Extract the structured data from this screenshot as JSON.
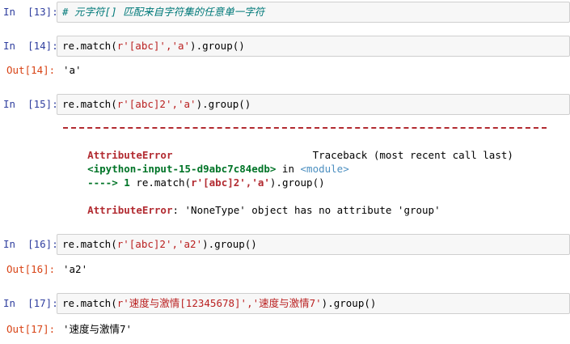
{
  "cells": {
    "c13": {
      "prompt": "In  [13]:",
      "comment": "# 元字符[] 匹配来自字符集的任意单一字符"
    },
    "c14": {
      "prompt": "In  [14]:",
      "code_pre": "re.match(",
      "code_str": "r'[abc]','a'",
      "code_post": ").group()",
      "out_prompt": "Out[14]:",
      "output": "'a'"
    },
    "c15": {
      "prompt": "In  [15]:",
      "code_pre": "re.match(",
      "code_str": "r'[abc]2','a'",
      "code_post": ").group()",
      "tb_error": "AttributeError",
      "tb_traceback": "Traceback (most recent call last)",
      "tb_input": "<ipython-input-15-d9abc7c84edb>",
      "tb_in": " in ",
      "tb_module": "<module>",
      "tb_arrow": "----> 1 ",
      "tb_code_pre": "re.match(",
      "tb_code_str": "r'[abc]2','a'",
      "tb_code_post": ").group()",
      "tb_final_name": "AttributeError",
      "tb_final_msg": ": 'NoneType' object has no attribute 'group'"
    },
    "c16": {
      "prompt": "In  [16]:",
      "code_pre": "re.match(",
      "code_str": "r'[abc]2','a2'",
      "code_post": ").group()",
      "out_prompt": "Out[16]:",
      "output": "'a2'"
    },
    "c17": {
      "prompt": "In  [17]:",
      "code_pre": "re.match(",
      "code_str": "r'速度与激情[12345678]','速度与激情7'",
      "code_post": ").group()",
      "out_prompt": "Out[17]:",
      "output": "'速度与激情7'"
    }
  }
}
